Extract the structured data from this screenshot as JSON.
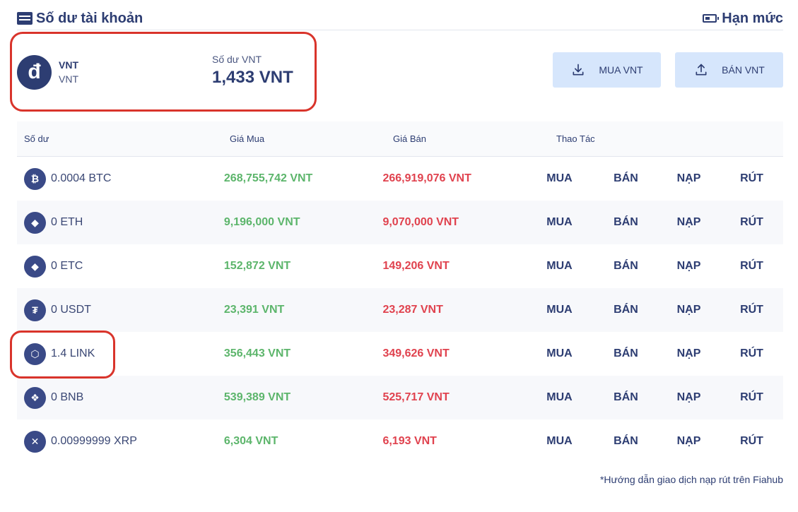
{
  "header": {
    "title": "Số dư tài khoản",
    "limit_label": "Hạn mức"
  },
  "vnt": {
    "coin_symbol_glyph": "đ",
    "symbol": "VNT",
    "name": "VNT",
    "balance_label": "Số dư VNT",
    "balance_value": "1,433 VNT"
  },
  "actions": {
    "buy_label": "MUA VNT",
    "sell_label": "BÁN VNT"
  },
  "table": {
    "headers": {
      "balance": "Số dư",
      "buy_price": "Giá Mua",
      "sell_price": "Giá Bán",
      "actions": "Thao Tác"
    },
    "action_labels": {
      "buy": "MUA",
      "sell": "BÁN",
      "deposit": "NẠP",
      "withdraw": "RÚT"
    },
    "rows": [
      {
        "icon": "bitcoin-icon",
        "glyph": "₿",
        "balance": "0.0004 BTC",
        "buy": "268,755,742 VNT",
        "sell": "266,919,076 VNT"
      },
      {
        "icon": "ethereum-icon",
        "glyph": "◆",
        "balance": "0 ETH",
        "buy": "9,196,000 VNT",
        "sell": "9,070,000 VNT"
      },
      {
        "icon": "ethereum-classic-icon",
        "glyph": "◆",
        "balance": "0 ETC",
        "buy": "152,872 VNT",
        "sell": "149,206 VNT"
      },
      {
        "icon": "tether-icon",
        "glyph": "₮",
        "balance": "0 USDT",
        "buy": "23,391 VNT",
        "sell": "23,287 VNT"
      },
      {
        "icon": "chainlink-icon",
        "glyph": "⬡",
        "balance": "1.4 LINK",
        "buy": "356,443 VNT",
        "sell": "349,626 VNT"
      },
      {
        "icon": "binance-icon",
        "glyph": "❖",
        "balance": "0 BNB",
        "buy": "539,389 VNT",
        "sell": "525,717 VNT"
      },
      {
        "icon": "ripple-icon",
        "glyph": "✕",
        "balance": "0.00999999 XRP",
        "buy": "6,304 VNT",
        "sell": "6,193 VNT"
      }
    ]
  },
  "footnote": "*Hướng dẫn giao dịch nạp rút trên Fiahub",
  "colors": {
    "primary": "#2d3d72",
    "buy": "#5cb56b",
    "sell": "#e0424e",
    "button_bg": "#d6e6fc",
    "highlight": "#d9342b"
  }
}
